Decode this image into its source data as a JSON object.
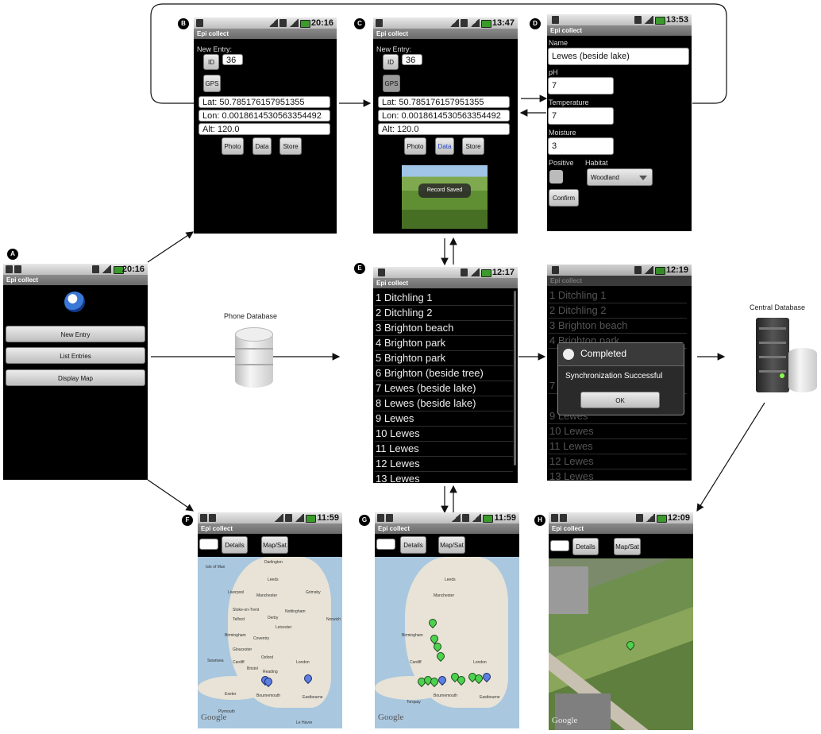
{
  "app_title": "Epi collect",
  "badges": {
    "a": "A",
    "b": "B",
    "c": "C",
    "d": "D",
    "e": "E",
    "f": "F",
    "g": "G",
    "h": "H"
  },
  "screenA": {
    "time": "20:16",
    "buttons": [
      "New Entry",
      "List Entries",
      "Display Map"
    ]
  },
  "screenB": {
    "time": "20:16",
    "new_entry_label": "New Entry:",
    "id_label": "ID",
    "id_value": "36",
    "gps_label": "GPS",
    "lat": "Lat: 50.785176157951355",
    "lon": "Lon: 0.0018614530563354492",
    "alt": "Alt: 120.0",
    "buttons": [
      "Photo",
      "Data",
      "Store"
    ]
  },
  "screenC": {
    "time": "13:47",
    "new_entry_label": "New Entry:",
    "id_label": "ID",
    "id_value": "36",
    "gps_label": "GPS",
    "lat": "Lat: 50.785176157951355",
    "lon": "Lon: 0.0018614530563354492",
    "alt": "Alt: 120.0",
    "buttons": [
      "Photo",
      "Data",
      "Store"
    ],
    "toast": "Record Saved"
  },
  "screenD": {
    "time": "13:53",
    "name_label": "Name",
    "name_value": "Lewes (beside lake)",
    "ph_label": "pH",
    "ph_value": "7",
    "temp_label": "Temperature",
    "temp_value": "7",
    "moisture_label": "Moisture",
    "moisture_value": "3",
    "positive_label": "Positive",
    "habitat_label": "Habitat",
    "habitat_value": "Woodland",
    "confirm": "Confirm"
  },
  "screenE": {
    "time": "12:17",
    "items": [
      "1 Ditchling 1",
      "2 Ditchling 2",
      "3 Brighton beach",
      "4 Brighton park",
      "5 Brighton park",
      "6 Brighton (beside tree)",
      "7 Lewes (beside lake)",
      "8 Lewes (beside lake)",
      "9 Lewes",
      "10 Lewes",
      "11 Lewes",
      "12 Lewes",
      "13 Lewes"
    ]
  },
  "screenSync": {
    "time": "12:19",
    "items": [
      "1 Ditchling 1",
      "2 Ditchling 2",
      "3 Brighton beach",
      "4 Brighton park",
      "",
      "",
      "7",
      "",
      "9 Lewes",
      "10 Lewes",
      "11 Lewes",
      "12 Lewes",
      "13 Lewes"
    ],
    "dialog_title": "Completed",
    "dialog_message": "Synchronization Successful",
    "dialog_ok": "OK"
  },
  "phone_database": "Phone Database",
  "central_database": "Central Database",
  "screenF": {
    "time": "11:59",
    "details": "Details",
    "mapsat": "Map/Sat",
    "google": "Google"
  },
  "screenG": {
    "time": "11:59",
    "details": "Details",
    "mapsat": "Map/Sat",
    "google": "Google"
  },
  "screenH": {
    "time": "12:09",
    "details": "Details",
    "mapsat": "Map/Sat",
    "google": "Google"
  },
  "map_cities": [
    "Isle of Man",
    "Darlington",
    "Leeds",
    "Liverpool",
    "Manchester",
    "Grimsby",
    "Stoke-on-Trent",
    "Derby",
    "Nottingham",
    "Norwich",
    "Telford",
    "Leicester",
    "Birmingham",
    "Coventry",
    "Northampton",
    "Cambridge",
    "Gloucester",
    "Oxford",
    "Swansea",
    "Cardiff",
    "Bristol",
    "Reading",
    "London",
    "Southend-on-Sea",
    "Chelmsford",
    "Portsmouth",
    "Brighton",
    "Eastbourne",
    "Exeter",
    "Torquay",
    "Plymouth",
    "Bournemouth",
    "Le Havre"
  ]
}
